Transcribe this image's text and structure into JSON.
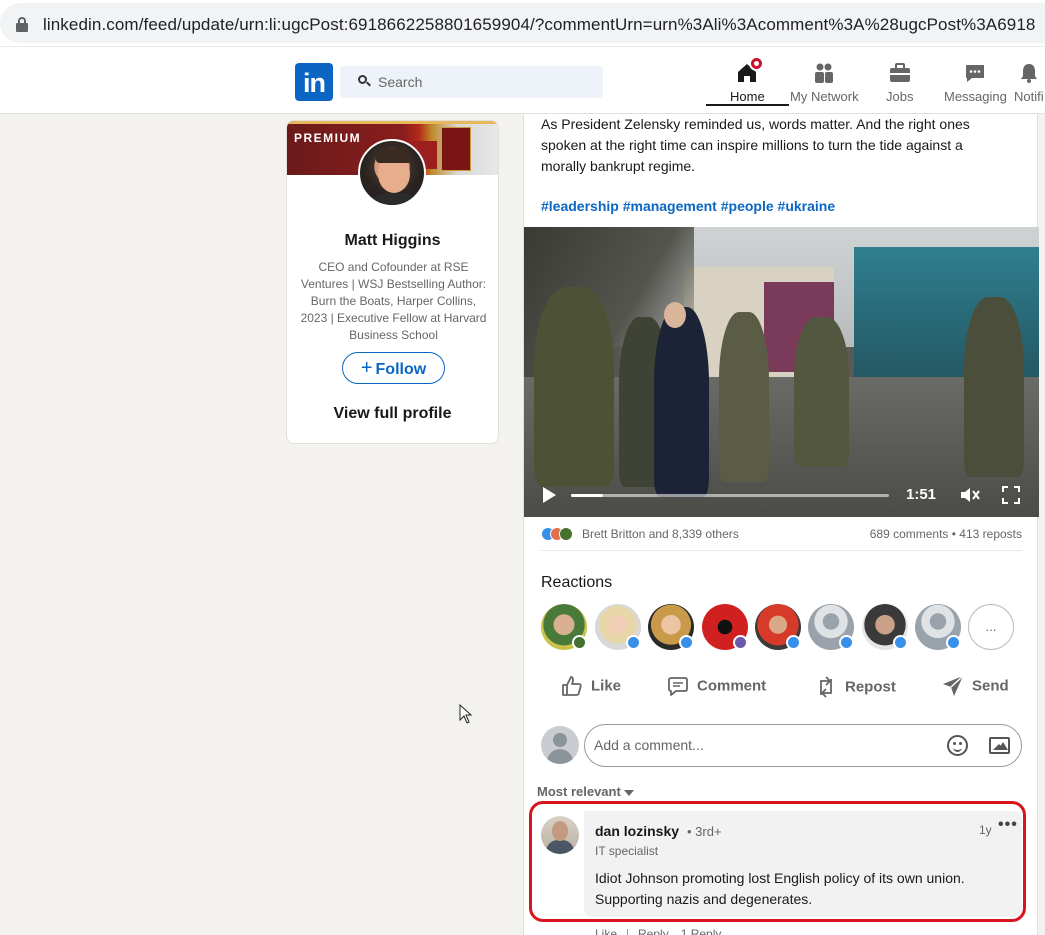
{
  "browser": {
    "url": "linkedin.com/feed/update/urn:li:ugcPost:6918662258801659904/?commentUrn=urn%3Ali%3Acomment%3A%28ugcPost%3A6918"
  },
  "nav": {
    "logo": "in",
    "search_placeholder": "Search",
    "items": [
      {
        "label": "Home",
        "icon": "home-icon",
        "active": true
      },
      {
        "label": "My Network",
        "icon": "network-icon"
      },
      {
        "label": "Jobs",
        "icon": "briefcase-icon"
      },
      {
        "label": "Messaging",
        "icon": "chat-icon"
      },
      {
        "label": "Notifi",
        "icon": "bell-icon"
      }
    ]
  },
  "profile": {
    "banner_label": "PREMIUM",
    "name": "Matt Higgins",
    "headline": "CEO and Cofounder at RSE Ventures | WSJ Bestselling Author: Burn the Boats, Harper Collins, 2023 | Executive Fellow at Harvard Business School",
    "follow_label": "Follow",
    "view_profile_label": "View full profile"
  },
  "post": {
    "text": "As President Zelensky reminded us, words matter. And the right ones spoken at the right time can inspire millions to turn the tide against a morally bankrupt regime.",
    "hashtags": "#leadership #management #people #ukraine",
    "video": {
      "duration": "1:51",
      "progress": 0.1
    },
    "social": {
      "reactors": "Brett Britton and 8,339 others",
      "counts": "689 comments • 413 reposts"
    },
    "reactions_title": "Reactions",
    "more_reactions": "...",
    "actions": {
      "like": "Like",
      "comment": "Comment",
      "repost": "Repost",
      "send": "Send"
    },
    "comment_placeholder": "Add a comment...",
    "sort_label": "Most relevant"
  },
  "comment": {
    "author": "dan lozinsky",
    "degree": "• 3rd+",
    "title": "IT specialist",
    "time": "1y",
    "more": "•••",
    "text": "Idiot Johnson promoting lost English policy of its own union. Supporting nazis and degenerates.",
    "like": "Like",
    "reply": "Reply",
    "replies": "1 Reply"
  },
  "colors": {
    "brand": "#0a66c2",
    "highlight": "#d8151e",
    "notification": "#cb112d"
  }
}
